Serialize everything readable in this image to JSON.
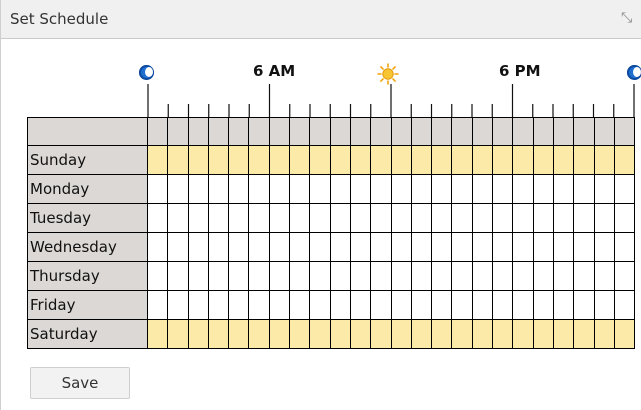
{
  "dialog": {
    "title": "Set Schedule",
    "close_icon": "⤡"
  },
  "timeline": {
    "labels": [
      "6 AM",
      "6 PM"
    ],
    "icons": [
      "moon-icon",
      "sun-icon",
      "moon-icon"
    ]
  },
  "schedule": {
    "days": [
      "Sunday",
      "Monday",
      "Tuesday",
      "Wednesday",
      "Thursday",
      "Friday",
      "Saturday"
    ],
    "enabled_days": [
      "Sunday",
      "Saturday"
    ]
  },
  "actions": {
    "save_label": "Save"
  },
  "colors": {
    "enabled_slot": "#fbeaa8",
    "header_cell": "#dcd8d5",
    "moon": "#1f6fd1",
    "sun": "#f6c531"
  }
}
